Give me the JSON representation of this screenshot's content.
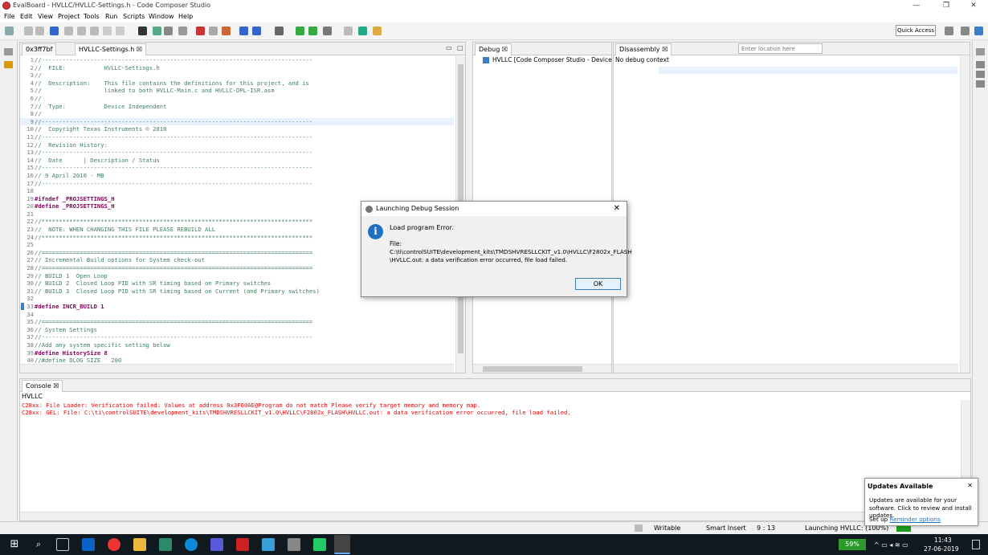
{
  "window": {
    "title": "EvalBoard - HVLLC/HVLLC-Settings.h - Code Composer Studio",
    "minimize": "—",
    "restore": "❐",
    "close": "✕"
  },
  "menu": [
    "File",
    "Edit",
    "View",
    "Project",
    "Tools",
    "Run",
    "Scripts",
    "Window",
    "Help"
  ],
  "quick_access": "Quick Access",
  "editor": {
    "tabs": [
      {
        "label": "0x3ff7bf"
      },
      {
        "label": "HVLLC-Settings.h",
        "close": "☒"
      }
    ],
    "lines": [
      {
        "n": "1",
        "t": "//------------------------------------------------------------------------------"
      },
      {
        "n": "2",
        "t": "//  FILE:           HVLLC-Settings.h"
      },
      {
        "n": "3",
        "t": "//"
      },
      {
        "n": "4",
        "t": "//  Description:    This file contains the definitions for this project, and is"
      },
      {
        "n": "5",
        "t": "//                  linked to both HVLLC-Main.c and HVLLC-DPL-ISR.asm"
      },
      {
        "n": "6",
        "t": "//"
      },
      {
        "n": "7",
        "t": "//  Type:           Device Independent"
      },
      {
        "n": "8",
        "t": "//"
      },
      {
        "n": "9",
        "t": "//------------------------------------------------------------------------------"
      },
      {
        "n": "10",
        "t": "//  Copyright Texas Instruments © 2010"
      },
      {
        "n": "11",
        "t": "//------------------------------------------------------------------------------"
      },
      {
        "n": "12",
        "t": "//  Revision History:"
      },
      {
        "n": "13",
        "t": "//------------------------------------------------------------------------------"
      },
      {
        "n": "14",
        "t": "//  Date      | Description / Status"
      },
      {
        "n": "15",
        "t": "//------------------------------------------------------------------------------"
      },
      {
        "n": "16",
        "t": "// 9 April 2010 - MB"
      },
      {
        "n": "17",
        "t": "//------------------------------------------------------------------------------"
      },
      {
        "n": "18",
        "t": ""
      },
      {
        "n": "19",
        "t": "#ifndef _PROJSETTINGS_H"
      },
      {
        "n": "20",
        "t": "#define _PROJSETTINGS_H"
      },
      {
        "n": "21",
        "t": ""
      },
      {
        "n": "22",
        "t": "//******************************************************************************"
      },
      {
        "n": "23",
        "t": "//  NOTE: WHEN CHANGING THIS FILE PLEASE REBUILD ALL"
      },
      {
        "n": "24",
        "t": "//******************************************************************************"
      },
      {
        "n": "25",
        "t": ""
      },
      {
        "n": "26",
        "t": "//=============================================================================="
      },
      {
        "n": "27",
        "t": "// Incremental Build options for System check-out"
      },
      {
        "n": "28",
        "t": "//=============================================================================="
      },
      {
        "n": "29",
        "t": "// BUILD 1  Open Loop"
      },
      {
        "n": "30",
        "t": "// BUILD 2  Closed Loop PID with SR timing based on Primary switches"
      },
      {
        "n": "31",
        "t": "// BUILD 3  Closed Loop PID with SR timing based on Current (and Primary switches)"
      },
      {
        "n": "32",
        "t": ""
      },
      {
        "n": "33",
        "t": "#define INCR_BUILD 1"
      },
      {
        "n": "34",
        "t": ""
      },
      {
        "n": "35",
        "t": "//=============================================================================="
      },
      {
        "n": "36",
        "t": "// System Settings"
      },
      {
        "n": "37",
        "t": "//------------------------------------------------------------------------------"
      },
      {
        "n": "38",
        "t": "//Add any system specific setting below"
      },
      {
        "n": "39",
        "t": "#define HistorySize 8"
      },
      {
        "n": "40",
        "t": "//#define DLOG_SIZE   200"
      }
    ]
  },
  "debug": {
    "tab": "Debug",
    "tab_close": "☒",
    "item": "HVLLC [Code Composer Studio - Device De"
  },
  "disassembly": {
    "tab": "Disassembly",
    "tab_close": "☒",
    "location_placeholder": "Enter location here",
    "context": "No debug context"
  },
  "console": {
    "tab": "Console",
    "tab_close": "☒",
    "project": "HVLLC",
    "lines": [
      "C28xx: File Loader: Verification failed: Values at address 0x3F60AE@Program do not match Please verify target memory and memory map.",
      "C28xx: GEL: File: C:\\ti\\controlSUITE\\development_kits\\TMDSHVRESLLCKIT_v1.0\\HVLLC\\F2802x_FLASH\\HVLLC.out: a data verification error occurred, file load failed."
    ]
  },
  "dialog": {
    "title": "Launching Debug Session",
    "heading": "Load program Error.",
    "file_label": "File:",
    "path_line1": "C:\\ti\\controlSUITE\\development_kits\\TMDSHVRESLLCKIT_v1.0\\HVLLC\\F2802x_FLASH",
    "path_line2": "\\HVLLC.out: a data verification error occurred, file load failed.",
    "ok": "OK",
    "close": "✕",
    "info_glyph": "i"
  },
  "status": {
    "mode": "Writable",
    "insert": "Smart Insert",
    "position": "9 : 13",
    "progress": "Launching HVLLC: (100%)"
  },
  "toast": {
    "title": "Updates Available",
    "text": "Updates are available for your software. Click to review and install updates.",
    "setup": "Set up",
    "link": "Reminder options",
    "close": "✕"
  },
  "taskbar": {
    "battery": "59%",
    "time": "11:43",
    "date": "27-06-2019"
  },
  "colors": {
    "accent": "#1e70c1",
    "error_text": "#e00000",
    "comment": "#3f7f5f",
    "keyword": "#7f0055"
  }
}
